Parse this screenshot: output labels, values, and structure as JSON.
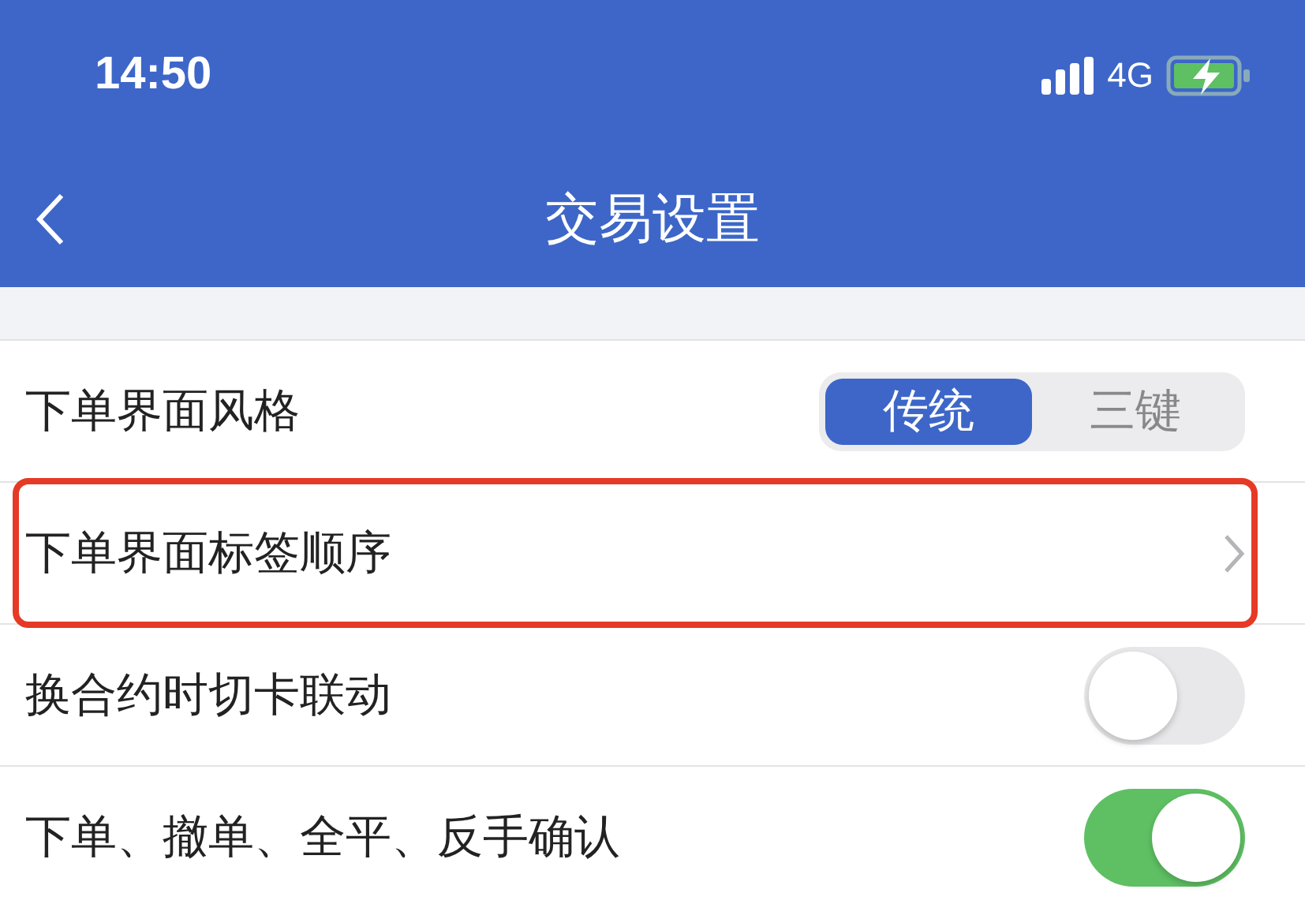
{
  "status_bar": {
    "time": "14:50",
    "network": "4G"
  },
  "nav": {
    "title": "交易设置"
  },
  "rows": [
    {
      "kind": "segmented",
      "label": "下单界面风格",
      "highlighted": false,
      "options": [
        {
          "label": "传统",
          "selected": true
        },
        {
          "label": "三键",
          "selected": false
        }
      ]
    },
    {
      "kind": "link",
      "label": "下单界面标签顺序",
      "highlighted": true
    },
    {
      "kind": "toggle",
      "label": "换合约时切卡联动",
      "highlighted": false,
      "on": false
    },
    {
      "kind": "toggle",
      "label": "下单、撤单、全平、反手确认",
      "highlighted": false,
      "on": true
    }
  ]
}
